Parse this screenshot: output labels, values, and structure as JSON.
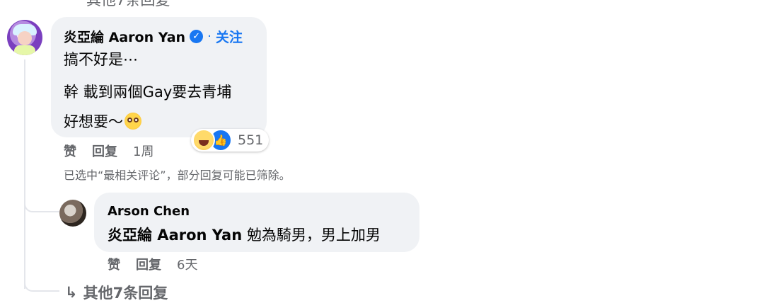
{
  "top_partial": "其他7条回复",
  "comment": {
    "author": "炎亞綸 Aaron Yan",
    "verified_icon": "verified-badge-icon",
    "separator": "·",
    "follow_label": "关注",
    "lines": [
      "搞不好是⋯",
      "幹 載到兩個Gay要去青埔",
      "好想要～"
    ],
    "emoji": "flushed-face-icon",
    "reactions": {
      "icons": [
        "haha-reaction-icon",
        "like-reaction-icon"
      ],
      "count": "551"
    },
    "actions": {
      "like": "赞",
      "reply": "回复",
      "time": "1周"
    }
  },
  "filter_note": "已选中“最相关评论”，部分回复可能已筛除。",
  "reply": {
    "author": "Arson Chen",
    "mention": "炎亞綸 Aaron Yan",
    "text": " 勉為騎男，男上加男",
    "actions": {
      "like": "赞",
      "reply": "回复",
      "time": "6天"
    }
  },
  "more_replies": {
    "icon": "reply-arrow-icon",
    "label": "其他7条回复"
  },
  "colors": {
    "accent": "#1877f2",
    "bubble": "#f0f2f5",
    "meta": "#65676b",
    "thread": "#e4e6eb"
  }
}
